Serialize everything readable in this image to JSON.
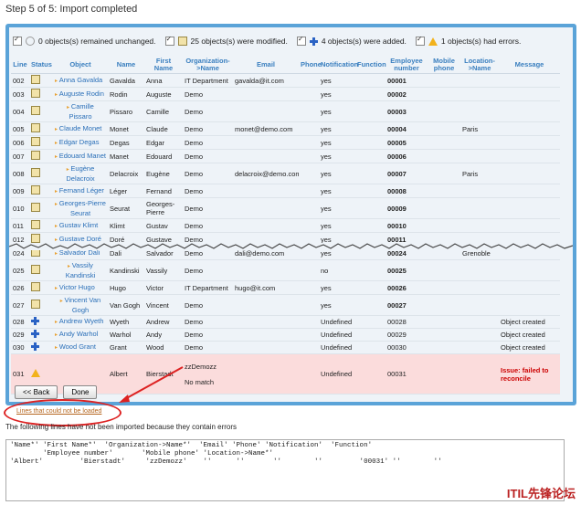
{
  "title": "Step 5 of 5: Import completed",
  "summary": {
    "unchanged": "0 objects(s) remained unchanged.",
    "modified": "25 objects(s) were modified.",
    "added": "4 objects(s) were added.",
    "errors": "1 objects(s) had errors."
  },
  "columns": [
    "Line",
    "Status",
    "Object",
    "Name",
    "First Name",
    "Organization->Name",
    "Email",
    "Phone",
    "Notification",
    "Function",
    "Employee number",
    "Mobile phone",
    "Location->Name",
    "Message"
  ],
  "rows_top": [
    {
      "line": "002",
      "status": "mod",
      "object": "Anna Gavalda",
      "name": "Gavalda",
      "first": "Anna",
      "org": "IT Department",
      "email": "gavalda@it.com",
      "phone": "",
      "notif": "yes",
      "func": "",
      "emp": "00001",
      "mobile": "",
      "loc": "",
      "msg": ""
    },
    {
      "line": "003",
      "status": "mod",
      "object": "Auguste Rodin",
      "name": "Rodin",
      "first": "Auguste",
      "org": "Demo",
      "email": "",
      "phone": "",
      "notif": "yes",
      "func": "",
      "emp": "00002",
      "mobile": "",
      "loc": "",
      "msg": ""
    },
    {
      "line": "004",
      "status": "mod",
      "object": "Camille Pissaro",
      "name": "Pissaro",
      "first": "Camille",
      "org": "Demo",
      "email": "",
      "phone": "",
      "notif": "yes",
      "func": "",
      "emp": "00003",
      "mobile": "",
      "loc": "",
      "msg": ""
    },
    {
      "line": "005",
      "status": "mod",
      "object": "Claude Monet",
      "name": "Monet",
      "first": "Claude",
      "org": "Demo",
      "email": "monet@demo.com",
      "phone": "",
      "notif": "yes",
      "func": "",
      "emp": "00004",
      "mobile": "",
      "loc": "Paris",
      "msg": ""
    },
    {
      "line": "006",
      "status": "mod",
      "object": "Edgar Degas",
      "name": "Degas",
      "first": "Edgar",
      "org": "Demo",
      "email": "",
      "phone": "",
      "notif": "yes",
      "func": "",
      "emp": "00005",
      "mobile": "",
      "loc": "",
      "msg": ""
    },
    {
      "line": "007",
      "status": "mod",
      "object": "Edouard Manet",
      "name": "Manet",
      "first": "Edouard",
      "org": "Demo",
      "email": "",
      "phone": "",
      "notif": "yes",
      "func": "",
      "emp": "00006",
      "mobile": "",
      "loc": "",
      "msg": ""
    },
    {
      "line": "008",
      "status": "mod",
      "object": "Eugène Delacroix",
      "name": "Delacroix",
      "first": "Eugène",
      "org": "Demo",
      "email": "delacroix@demo.com",
      "phone": "",
      "notif": "yes",
      "func": "",
      "emp": "00007",
      "mobile": "",
      "loc": "Paris",
      "msg": ""
    },
    {
      "line": "009",
      "status": "mod",
      "object": "Fernand Léger",
      "name": "Léger",
      "first": "Fernand",
      "org": "Demo",
      "email": "",
      "phone": "",
      "notif": "yes",
      "func": "",
      "emp": "00008",
      "mobile": "",
      "loc": "",
      "msg": ""
    },
    {
      "line": "010",
      "status": "mod",
      "object": "Georges-Pierre Seurat",
      "name": "Seurat",
      "first": "Georges-Pierre",
      "org": "Demo",
      "email": "",
      "phone": "",
      "notif": "yes",
      "func": "",
      "emp": "00009",
      "mobile": "",
      "loc": "",
      "msg": ""
    },
    {
      "line": "011",
      "status": "mod",
      "object": "Gustav Klimt",
      "name": "Klimt",
      "first": "Gustav",
      "org": "Demo",
      "email": "",
      "phone": "",
      "notif": "yes",
      "func": "",
      "emp": "00010",
      "mobile": "",
      "loc": "",
      "msg": ""
    },
    {
      "line": "012",
      "status": "mod",
      "object": "Gustave Doré",
      "name": "Doré",
      "first": "Gustave",
      "org": "Demo",
      "email": "",
      "phone": "",
      "notif": "yes",
      "func": "",
      "emp": "00011",
      "mobile": "",
      "loc": "",
      "msg": ""
    }
  ],
  "rows_bottom": [
    {
      "line": "024",
      "status": "mod",
      "object": "Salvador Dali",
      "name": "Dali",
      "first": "Salvador",
      "org": "Demo",
      "email": "dali@demo.com",
      "phone": "",
      "notif": "yes",
      "func": "",
      "emp": "00024",
      "mobile": "",
      "loc": "Grenoble",
      "msg": ""
    },
    {
      "line": "025",
      "status": "mod",
      "object": "Vassily Kandinski",
      "name": "Kandinski",
      "first": "Vassily",
      "org": "Demo",
      "email": "",
      "phone": "",
      "notif": "no",
      "func": "",
      "emp": "00025",
      "mobile": "",
      "loc": "",
      "msg": ""
    },
    {
      "line": "026",
      "status": "mod",
      "object": "Victor Hugo",
      "name": "Hugo",
      "first": "Victor",
      "org": "IT Department",
      "email": "hugo@it.com",
      "phone": "",
      "notif": "yes",
      "func": "",
      "emp": "00026",
      "mobile": "",
      "loc": "",
      "msg": ""
    },
    {
      "line": "027",
      "status": "mod",
      "object": "Vincent Van Gogh",
      "name": "Van Gogh",
      "first": "Vincent",
      "org": "Demo",
      "email": "",
      "phone": "",
      "notif": "yes",
      "func": "",
      "emp": "00027",
      "mobile": "",
      "loc": "",
      "msg": ""
    },
    {
      "line": "028",
      "status": "add",
      "object": "Andrew Wyeth",
      "name": "Wyeth",
      "first": "Andrew",
      "org": "Demo",
      "email": "",
      "phone": "",
      "notif": "Undefined",
      "func": "",
      "emp": "00028",
      "mobile": "",
      "loc": "",
      "msg": "Object created"
    },
    {
      "line": "029",
      "status": "add",
      "object": "Andy Warhol",
      "name": "Warhol",
      "first": "Andy",
      "org": "Demo",
      "email": "",
      "phone": "",
      "notif": "Undefined",
      "func": "",
      "emp": "00029",
      "mobile": "",
      "loc": "",
      "msg": "Object created"
    },
    {
      "line": "030",
      "status": "add",
      "object": "Wood Grant",
      "name": "Grant",
      "first": "Wood",
      "org": "Demo",
      "email": "",
      "phone": "",
      "notif": "Undefined",
      "func": "",
      "emp": "00030",
      "mobile": "",
      "loc": "",
      "msg": "Object created"
    }
  ],
  "error_row": {
    "line": "031",
    "name": "Albert",
    "first": "Bierstadt",
    "org": "zzDemozz",
    "org_note": "No match",
    "notif": "Undefined",
    "emp": "00031",
    "msg": "Issue: failed to reconcile"
  },
  "buttons": {
    "back": "<< Back",
    "done": "Done"
  },
  "link_lines": "Lines that could not be loaded",
  "notice": "The following lines have not been imported because they contain errors",
  "error_text": "'Name*' 'First Name*'  'Organization->Name*'  'Email' 'Phone' 'Notification'  'Function'\n        'Employee number'       'Mobile phone' 'Location->Name*'\n'Albert'         'Bierstadt'     'zzDemozz'    ''      ''       ''        ''         '00031' ''        ''",
  "watermark": "ITIL先锋论坛"
}
